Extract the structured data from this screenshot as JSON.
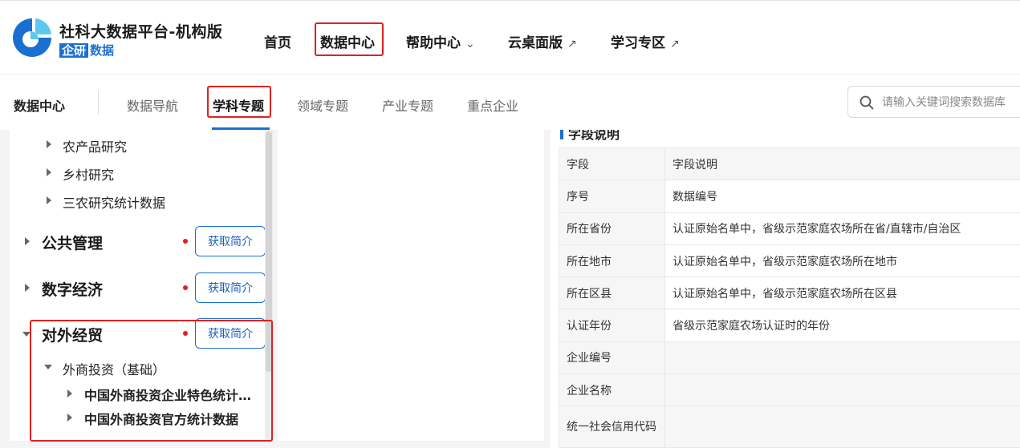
{
  "brand": {
    "title": "社科大数据平台-机构版",
    "badge": "企研",
    "sub": "数据",
    "logo_colors": [
      "#1a6fd1",
      "#5cc8f0"
    ]
  },
  "topnav": [
    {
      "label": "首页"
    },
    {
      "label": "数据中心"
    },
    {
      "label": "帮助中心",
      "suffix": "⌄"
    },
    {
      "label": "云桌面版",
      "suffix": "↗"
    },
    {
      "label": "学习专区",
      "suffix": "↗"
    }
  ],
  "subnav": {
    "home": "数据中心",
    "tabs": [
      "数据导航",
      "学科专题",
      "领域专题",
      "产业专题",
      "重点企业"
    ],
    "active_index": 1,
    "search_placeholder": "请输入关键词搜索数据库"
  },
  "tree": {
    "agri_children": [
      "农产品研究",
      "乡村研究",
      "三农研究统计数据"
    ],
    "categories": [
      {
        "label": "公共管理",
        "button": "获取简介"
      },
      {
        "label": "数字经济",
        "button": "获取简介"
      },
      {
        "label": "对外经贸",
        "button": "获取简介"
      }
    ],
    "trade_sub": "外商投资（基础）",
    "trade_leaves": [
      "中国外商投资企业特色统计数据",
      "中国外商投资官方统计数据"
    ]
  },
  "fields_section": {
    "title": "字段说明",
    "header": [
      "字段",
      "字段说明"
    ],
    "rows": [
      [
        "序号",
        "数据编号"
      ],
      [
        "所在省份",
        "认证原始名单中，省级示范家庭农场所在省/直辖市/自治区"
      ],
      [
        "所在地市",
        "认证原始名单中，省级示范家庭农场所在地市"
      ],
      [
        "所在区县",
        "认证原始名单中，省级示范家庭农场所在区县"
      ],
      [
        "认证年份",
        "省级示范家庭农场认证时的年份"
      ],
      [
        "企业编号",
        ""
      ],
      [
        "企业名称",
        ""
      ],
      [
        "统一社会信用代码",
        ""
      ]
    ]
  },
  "colors": {
    "accent": "#1a6fd1",
    "highlight": "#e02020",
    "dot": "#e02020"
  }
}
